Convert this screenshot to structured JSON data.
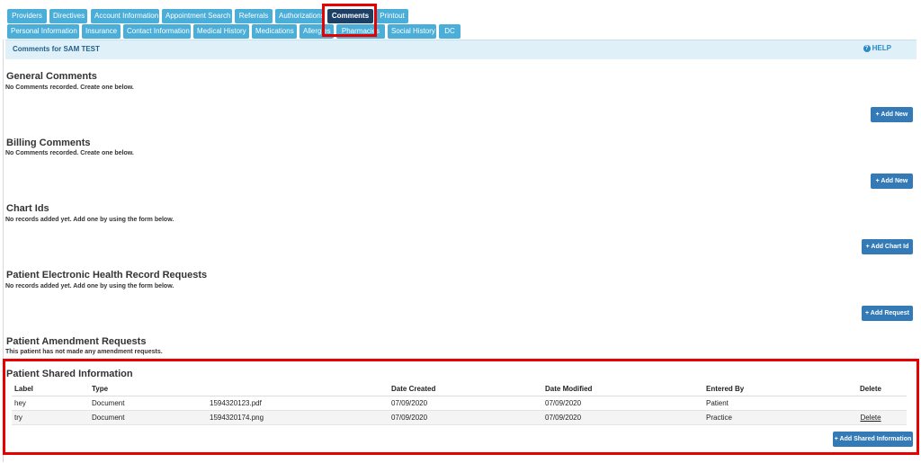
{
  "tabs_row1": [
    {
      "label": "Providers"
    },
    {
      "label": "Directives"
    },
    {
      "label": "Account Information"
    },
    {
      "label": "Appointment Search"
    },
    {
      "label": "Referrals"
    },
    {
      "label": "Authorizations"
    },
    {
      "label": "Comments",
      "active": true
    },
    {
      "label": "Printout"
    }
  ],
  "tabs_row2": [
    {
      "label": "Personal Information"
    },
    {
      "label": "Insurance"
    },
    {
      "label": "Contact Information"
    },
    {
      "label": "Medical History"
    },
    {
      "label": "Medications"
    },
    {
      "label": "Allergies"
    },
    {
      "label": "Pharmacies"
    },
    {
      "label": "Social History"
    },
    {
      "label": "DC"
    }
  ],
  "header": {
    "title": "Comments for SAM TEST",
    "help_label": "HELP",
    "help_icon": "question-circle-icon"
  },
  "sections": {
    "general": {
      "title": "General Comments",
      "message": "No Comments recorded. Create one below.",
      "button": "+ Add New"
    },
    "billing": {
      "title": "Billing Comments",
      "message": "No Comments recorded. Create one below.",
      "button": "+ Add New"
    },
    "chart": {
      "title": "Chart Ids",
      "message": "No records added yet. Add one by using the form below.",
      "button": "+ Add Chart Id"
    },
    "ehr": {
      "title": "Patient Electronic Health Record Requests",
      "message": "No records added yet. Add one by using the form below.",
      "button": "+ Add Request"
    },
    "amendment": {
      "title": "Patient Amendment Requests",
      "message": "This patient has not made any amendment requests."
    },
    "shared": {
      "title": "Patient Shared Information",
      "columns": [
        "Label",
        "Type",
        "",
        "Date Created",
        "Date Modified",
        "Entered By",
        "Delete"
      ],
      "rows": [
        {
          "label": "hey",
          "type": "Document",
          "file": "1594320123.pdf",
          "created": "07/09/2020",
          "modified": "07/09/2020",
          "entered_by": "Patient",
          "delete": ""
        },
        {
          "label": "try",
          "type": "Document",
          "file": "1594320174.png",
          "created": "07/09/2020",
          "modified": "07/09/2020",
          "entered_by": "Practice",
          "delete": "Delete"
        }
      ],
      "button": "+ Add Shared Information"
    }
  },
  "colors": {
    "tab": "#4aaed8",
    "tab_active": "#1d3f66",
    "button": "#337ab7",
    "highlight": "#e60000",
    "link": "#2a8ac7"
  }
}
